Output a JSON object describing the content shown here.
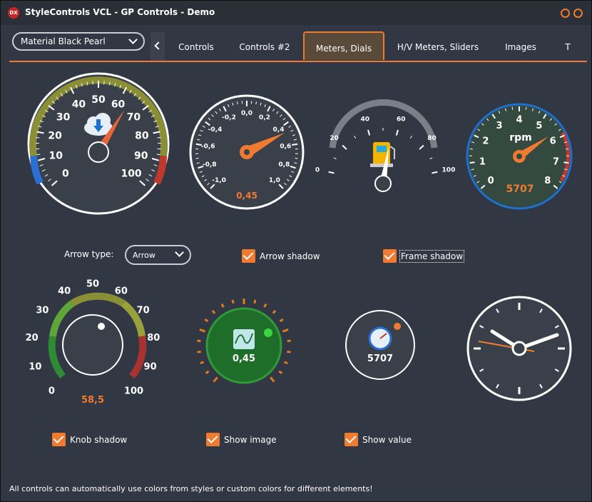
{
  "window": {
    "title": "StyleControls VCL - GP Controls - Demo",
    "icon_text": "DX"
  },
  "style_combo": {
    "value": "Material Black Pearl"
  },
  "tabs": [
    {
      "label": "Controls"
    },
    {
      "label": "Controls #2"
    },
    {
      "label": "Meters, Dials"
    },
    {
      "label": "H/V Meters, Sliders"
    },
    {
      "label": "Images"
    },
    {
      "label": "T"
    }
  ],
  "controls": {
    "arrow_type_label": "Arrow type:",
    "arrow_type_value": "Arrow",
    "arrow_shadow": "Arrow shadow",
    "frame_shadow": "Frame shadow",
    "knob_shadow": "Knob shadow",
    "show_image": "Show image",
    "show_value": "Show value"
  },
  "gauges": {
    "speed": {
      "ticks": [
        "0",
        "10",
        "20",
        "30",
        "40",
        "50",
        "60",
        "70",
        "80",
        "90",
        "100"
      ],
      "value": 62
    },
    "minus_one": {
      "ticks": [
        "-1,0",
        "-0,8",
        "-0,6",
        "-0,4",
        "-0,2",
        "0,0",
        "0,2",
        "0,4",
        "0,6",
        "0,8",
        "1,0"
      ],
      "value_text": "0,45"
    },
    "fuel": {
      "ticks": [
        "0",
        "20",
        "40",
        "60",
        "80",
        "100"
      ]
    },
    "rpm": {
      "ticks": [
        "0",
        "1",
        "2",
        "3",
        "4",
        "5",
        "6",
        "7",
        "8"
      ],
      "unit": "rpm",
      "value_text": "5707"
    },
    "knob": {
      "ticks": [
        "0",
        "10",
        "20",
        "30",
        "40",
        "50",
        "60",
        "70",
        "80",
        "90",
        "100"
      ],
      "value_text": "58,5"
    },
    "green_dial": {
      "value_text": "0,45"
    },
    "small_dial": {
      "value_text": "5707"
    }
  },
  "colors": {
    "accent": "#f07a30",
    "bg": "#313743",
    "green": "#1e7a2a",
    "blue": "#1e6fd0"
  },
  "footer": "All controls can automatically use colors from styles or custom colors for different elements!"
}
